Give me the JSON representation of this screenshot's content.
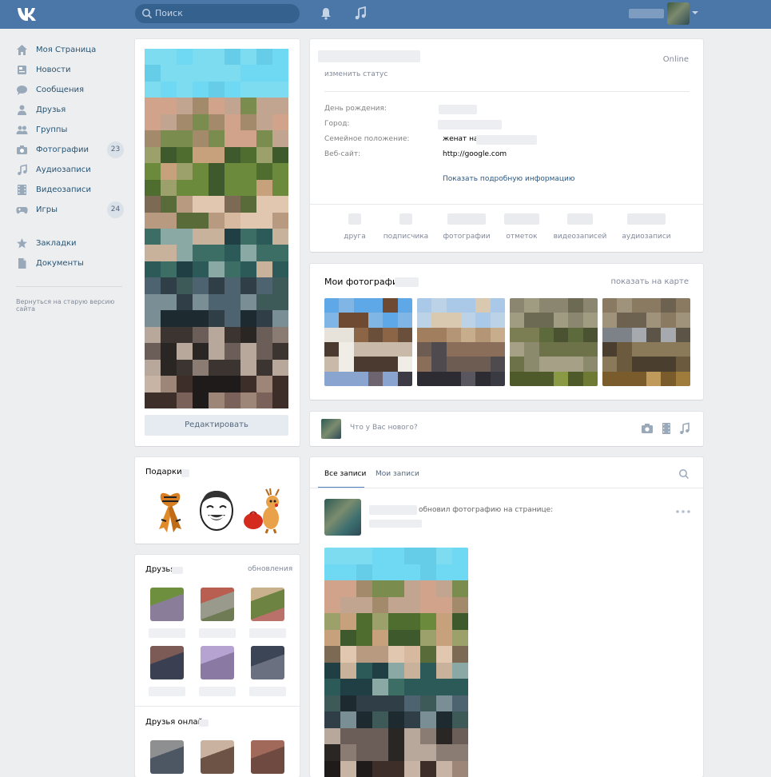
{
  "header": {
    "logo": "VK",
    "search_placeholder": "Поиск",
    "icons": [
      "bell-icon",
      "music-icon"
    ],
    "colors": {
      "bar": "#4a76a8",
      "search": "#35618f"
    }
  },
  "sidebar": {
    "items": [
      {
        "label": "Моя Страница",
        "icon": "home-icon",
        "badge": ""
      },
      {
        "label": "Новости",
        "icon": "news-icon",
        "badge": ""
      },
      {
        "label": "Сообщения",
        "icon": "messages-icon",
        "badge": ""
      },
      {
        "label": "Друзья",
        "icon": "friend-icon",
        "badge": ""
      },
      {
        "label": "Группы",
        "icon": "groups-icon",
        "badge": ""
      },
      {
        "label": "Фотографии",
        "icon": "camera-icon",
        "badge": "23"
      },
      {
        "label": "Аудиозаписи",
        "icon": "music-icon",
        "badge": ""
      },
      {
        "label": "Видеозаписи",
        "icon": "video-icon",
        "badge": ""
      },
      {
        "label": "Игры",
        "icon": "gamepad-icon",
        "badge": "24"
      },
      {
        "label": "Закладки",
        "icon": "star-icon",
        "badge": ""
      },
      {
        "label": "Документы",
        "icon": "document-icon",
        "badge": ""
      }
    ],
    "footer": "Вернуться на старую версию сайта"
  },
  "profile": {
    "edit_button": "Редактировать",
    "online": "Online",
    "status": "изменить статус",
    "info": [
      {
        "key": "День рождения:",
        "value": ""
      },
      {
        "key": "Город:",
        "value": ""
      },
      {
        "key": "Семейное положение:",
        "value": "женат на"
      },
      {
        "key": "Веб-сайт:",
        "value": "http://google.com"
      }
    ],
    "more_info": "Показать подробную информацию",
    "counters": [
      "друга",
      "подписчика",
      "фотографии",
      "отметок",
      "видеозаписей",
      "аудиозаписи"
    ]
  },
  "gifts": {
    "title": "Подарки"
  },
  "friends": {
    "title": "Друзья",
    "updates": "обновления",
    "online_title": "Друзья онлайн"
  },
  "photos": {
    "title": "Мои фотографии",
    "map_link": "показать на карте"
  },
  "post_box": {
    "placeholder": "Что у Вас нового?"
  },
  "wall": {
    "tabs": [
      "Все записи",
      "Мои записи"
    ],
    "post_text": "обновил фотографию на странице:"
  }
}
